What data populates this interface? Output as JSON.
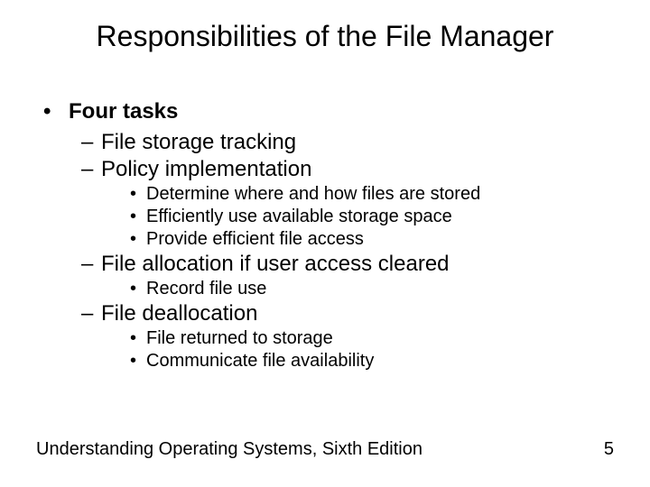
{
  "title": "Responsibilities of the File Manager",
  "l1": "Four tasks",
  "l2a": "File storage tracking",
  "l2b": "Policy implementation",
  "l3b1": "Determine where and how files are stored",
  "l3b2": "Efficiently use available storage space",
  "l3b3": "Provide efficient file access",
  "l2c": "File allocation if user access cleared",
  "l3c1": "Record file use",
  "l2d": "File deallocation",
  "l3d1": "File returned to storage",
  "l3d2": "Communicate file availability",
  "footer_left": "Understanding Operating Systems, Sixth Edition",
  "footer_right": "5"
}
